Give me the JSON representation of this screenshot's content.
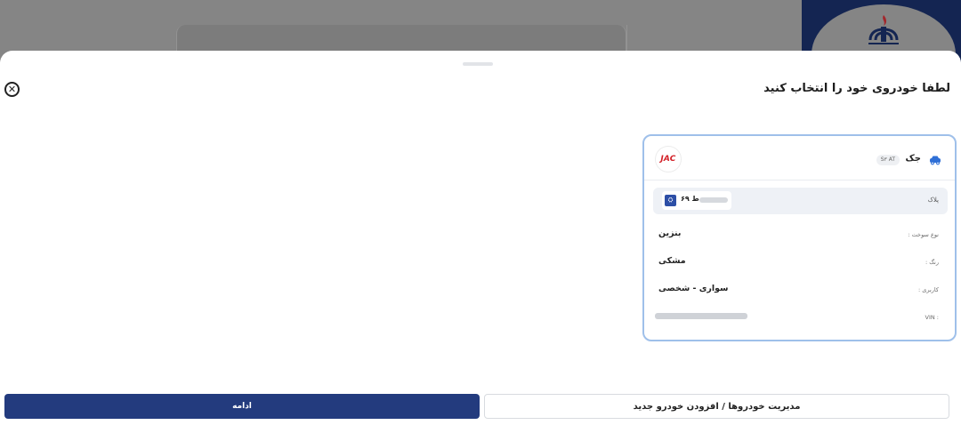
{
  "sheet": {
    "title": "لطفا خودروی خود را انتخاب کنید",
    "close_icon": "close-circle-icon"
  },
  "vehicle": {
    "brand": "جک",
    "model": "S۳ AT",
    "logo_text": "JAC",
    "plate_label": "پلاک",
    "plate_number": "ط ۶۹",
    "fuel_label": "نوع سوخت :",
    "fuel_value": "بنزین",
    "color_label": "رنگ :",
    "color_value": "مشکی",
    "usage_label": "کاربری :",
    "usage_value": "سواری - شخصی",
    "vin_label": "VIN :"
  },
  "actions": {
    "continue_label": "ادامه",
    "manage_label": "مدیریت خودروها / افزودن خودرو جدید"
  },
  "colors": {
    "primary": "#233b7e",
    "card_border": "#9fc0ea",
    "brand_dark": "#142552",
    "jac_red": "#d32027"
  }
}
